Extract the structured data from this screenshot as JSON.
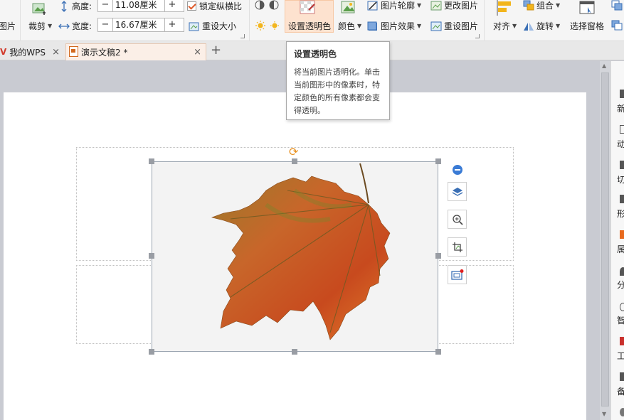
{
  "ribbon": {
    "picture_label": "图片",
    "crop_label": "裁剪",
    "height_label": "高度:",
    "height_value": "11.08厘米",
    "width_label": "宽度:",
    "width_value": "16.67厘米",
    "lock_ratio_label": "锁定纵横比",
    "reset_size_label": "重设大小",
    "set_transparent_label": "设置透明色",
    "color_label": "颜色",
    "picture_outline_label": "图片轮廓",
    "picture_effect_label": "图片效果",
    "change_picture_label": "更改图片",
    "reset_picture_label": "重设图片",
    "align_label": "对齐",
    "group_label": "组合",
    "rotate_label": "旋转",
    "selection_pane_label": "选择窗格",
    "minus": "−",
    "plus": "+"
  },
  "tabs": [
    {
      "label": "我的WPS",
      "close": "×"
    },
    {
      "label": "演示文稿2 *",
      "close": "×"
    }
  ],
  "new_tab": "+",
  "tooltip": {
    "title": "设置透明色",
    "body": "将当前图片透明化。单击当前图形中的像素时，特定颜色的所有像素都会变得透明。"
  },
  "right_panel": {
    "items": [
      "新",
      "动",
      "切",
      "形",
      "属",
      "分",
      "智",
      "工",
      "备"
    ]
  },
  "colors": {
    "accent_orange": "#e8901f",
    "active_fill": "#fde2cf",
    "handle": "#999da4"
  },
  "icons": [
    "rotate-icon",
    "layers-icon",
    "zoom-icon",
    "crop-icon",
    "frame-icon",
    "minus-icon"
  ]
}
